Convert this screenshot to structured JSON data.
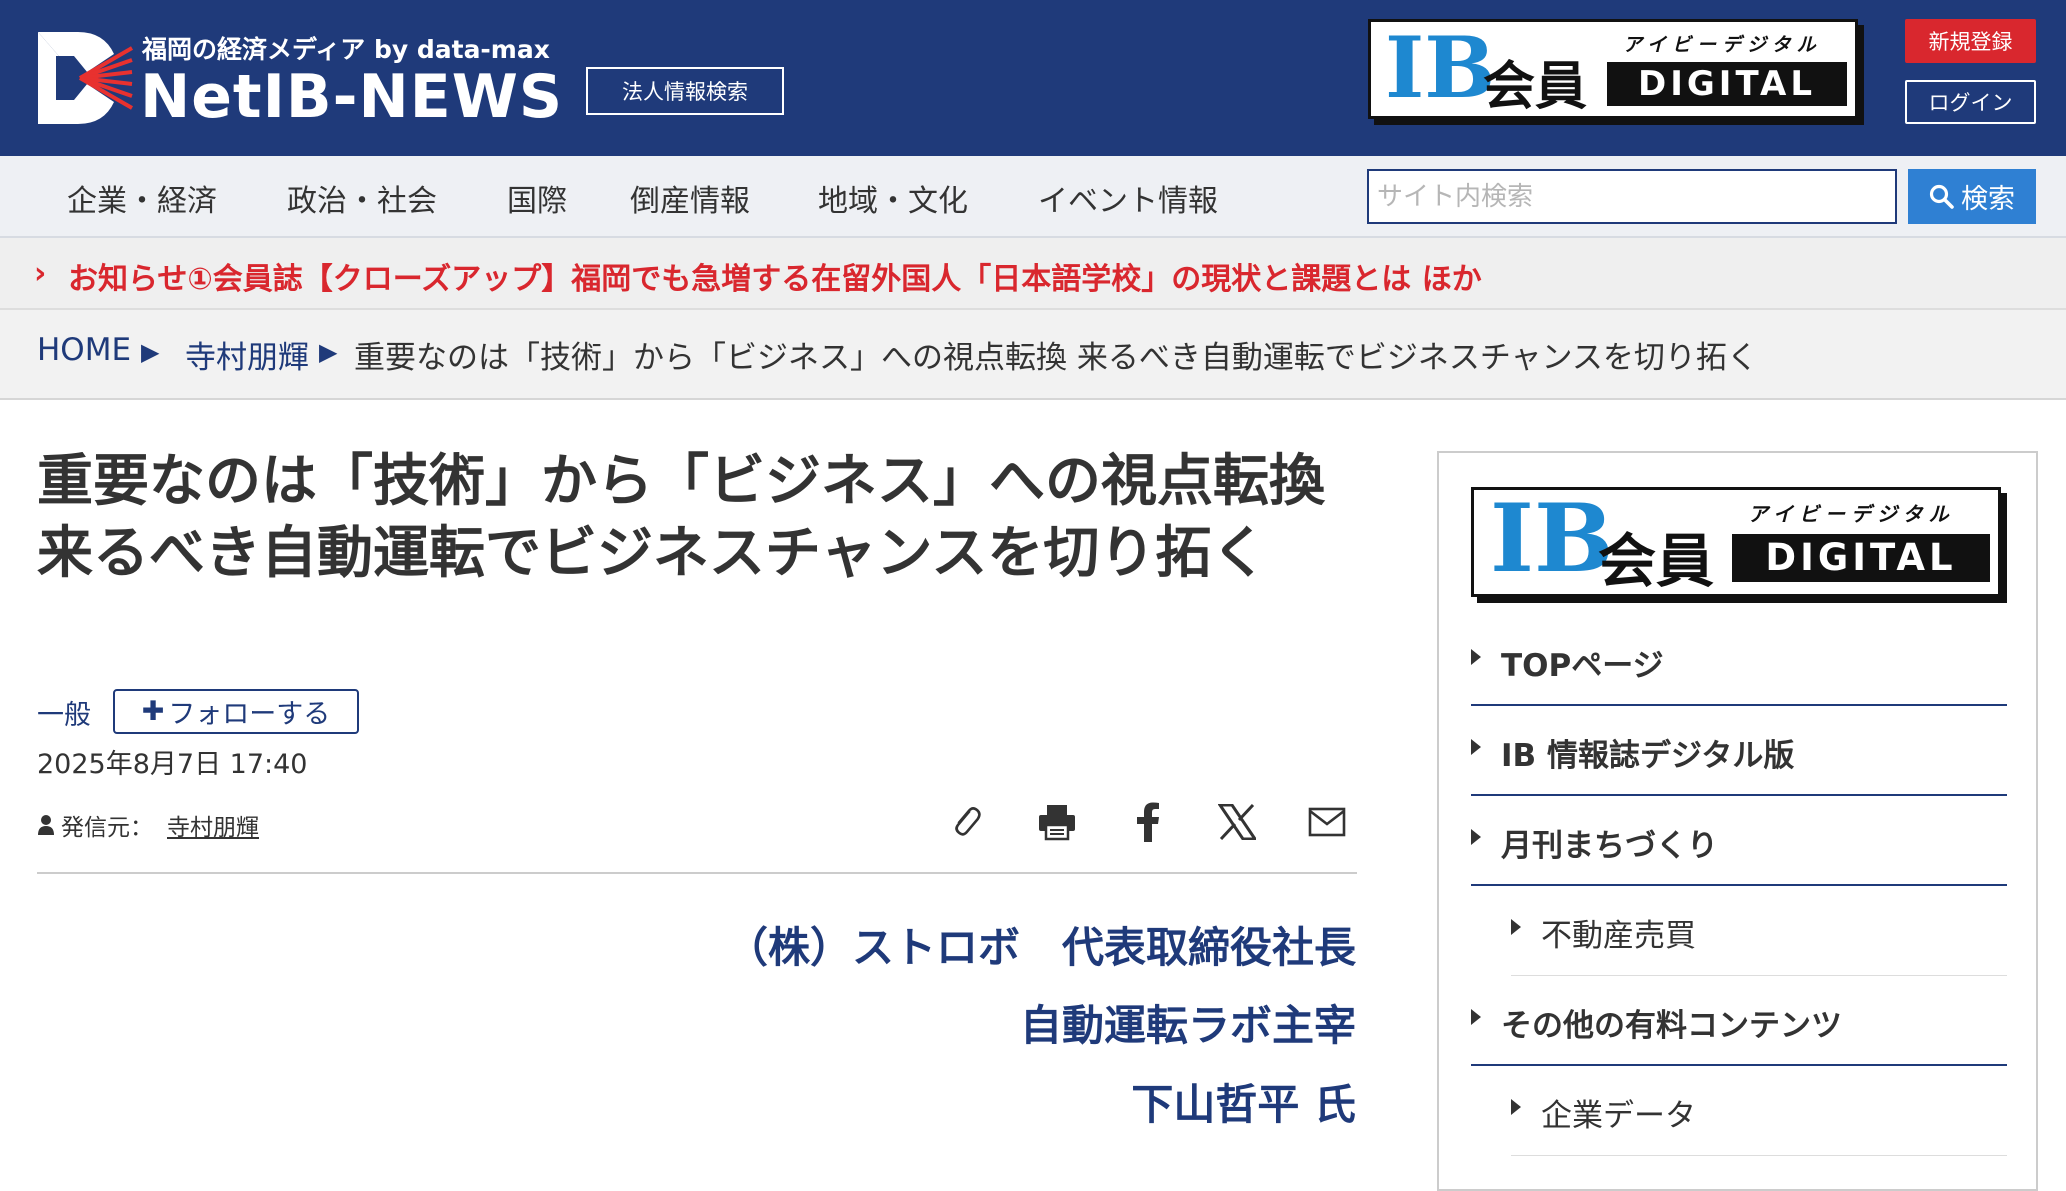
{
  "header": {
    "tagline": "福岡の経済メディア by data-max",
    "site_name": "NetIB-NEWS",
    "corp_search_label": "法人情報検索",
    "banner": {
      "ib": "IB",
      "kaiin": "会員",
      "kana": "アイビーデジタル",
      "digital": "DIGITAL"
    },
    "register_label": "新規登録",
    "login_label": "ログイン"
  },
  "nav": {
    "items": [
      "企業・経済",
      "政治・社会",
      "国際",
      "倒産情報",
      "地域・文化",
      "イベント情報"
    ],
    "search_placeholder": "サイト内検索",
    "search_button": "検索"
  },
  "notice": {
    "text": "お知らせ①会員誌【クローズアップ】福岡でも急増する在留外国人「日本語学校」の現状と課題とは ほか"
  },
  "breadcrumb": {
    "home": "HOME",
    "author": "寺村朋輝",
    "current": "重要なのは「技術」から「ビジネス」への視点転換 来るべき自動運転でビジネスチャンスを切り拓く"
  },
  "article": {
    "title": "重要なのは「技術」から「ビジネス」への視点転換 来るべき自動運転でビジネスチャンスを切り拓く",
    "category": "一般",
    "follow_label": "フォローする",
    "date": "2025年8月7日 17:40",
    "sender_label": "発信元：",
    "sender_name": "寺村朋輝",
    "person": [
      "（株）ストロボ　代表取締役社長",
      "自動運転ラボ主宰",
      "下山哲平 氏"
    ]
  },
  "sidebar": {
    "banner": {
      "ib": "IB",
      "kaiin": "会員",
      "kana": "アイビーデジタル",
      "digital": "DIGITAL"
    },
    "items": [
      {
        "label": "TOPページ",
        "sub": false
      },
      {
        "label": "IB 情報誌デジタル版",
        "sub": false
      },
      {
        "label": "月刊まちづくり",
        "sub": false
      },
      {
        "label": "不動産売買",
        "sub": true
      },
      {
        "label": "その他の有料コンテンツ",
        "sub": false
      },
      {
        "label": "企業データ",
        "sub": true
      }
    ]
  },
  "colors": {
    "brand_navy": "#1f3a7a",
    "alert_red": "#d9272e",
    "search_blue": "#2f80d3",
    "ib_blue": "#1e88d0"
  }
}
